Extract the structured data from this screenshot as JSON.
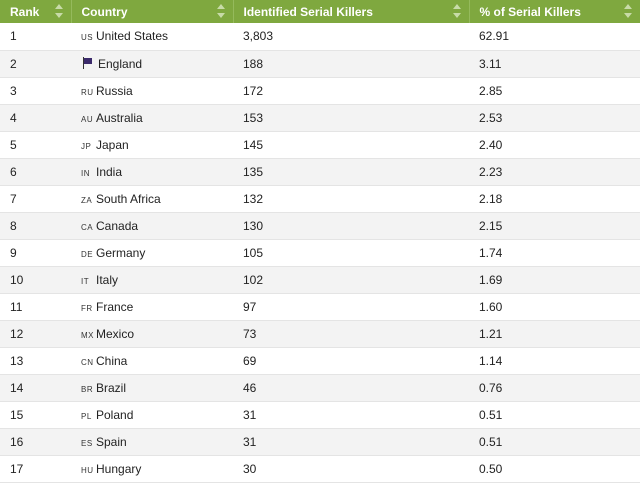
{
  "table": {
    "headers": {
      "rank": "Rank",
      "country": "Country",
      "killers": "Identified Serial Killers",
      "percent": "% of Serial Killers"
    },
    "colors": {
      "header_bg": "#7fa83f",
      "row_alt": "#f3f3f3"
    },
    "rows": [
      {
        "rank": "1",
        "code": "US",
        "country": "United States",
        "killers": "3,803",
        "percent": "62.91"
      },
      {
        "rank": "2",
        "code": "",
        "icon": "flag-icon",
        "country": "England",
        "killers": "188",
        "percent": "3.11"
      },
      {
        "rank": "3",
        "code": "RU",
        "country": "Russia",
        "killers": "172",
        "percent": "2.85"
      },
      {
        "rank": "4",
        "code": "AU",
        "country": "Australia",
        "killers": "153",
        "percent": "2.53"
      },
      {
        "rank": "5",
        "code": "JP",
        "country": "Japan",
        "killers": "145",
        "percent": "2.40"
      },
      {
        "rank": "6",
        "code": "IN",
        "country": "India",
        "killers": "135",
        "percent": "2.23"
      },
      {
        "rank": "7",
        "code": "ZA",
        "country": "South Africa",
        "killers": "132",
        "percent": "2.18"
      },
      {
        "rank": "8",
        "code": "CA",
        "country": "Canada",
        "killers": "130",
        "percent": "2.15"
      },
      {
        "rank": "9",
        "code": "DE",
        "country": "Germany",
        "killers": "105",
        "percent": "1.74"
      },
      {
        "rank": "10",
        "code": "IT",
        "country": "Italy",
        "killers": "102",
        "percent": "1.69"
      },
      {
        "rank": "11",
        "code": "FR",
        "country": "France",
        "killers": "97",
        "percent": "1.60"
      },
      {
        "rank": "12",
        "code": "MX",
        "country": "Mexico",
        "killers": "73",
        "percent": "1.21"
      },
      {
        "rank": "13",
        "code": "CN",
        "country": "China",
        "killers": "69",
        "percent": "1.14"
      },
      {
        "rank": "14",
        "code": "BR",
        "country": "Brazil",
        "killers": "46",
        "percent": "0.76"
      },
      {
        "rank": "15",
        "code": "PL",
        "country": "Poland",
        "killers": "31",
        "percent": "0.51"
      },
      {
        "rank": "16",
        "code": "ES",
        "country": "Spain",
        "killers": "31",
        "percent": "0.51"
      },
      {
        "rank": "17",
        "code": "HU",
        "country": "Hungary",
        "killers": "30",
        "percent": "0.50"
      }
    ]
  }
}
